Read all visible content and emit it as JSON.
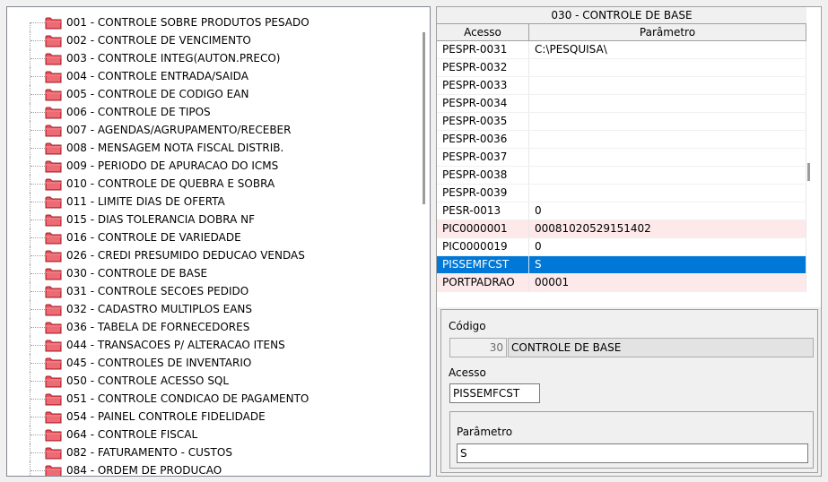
{
  "tree": {
    "items": [
      {
        "label": "001 - CONTROLE SOBRE PRODUTOS PESADO"
      },
      {
        "label": "002 - CONTROLE DE VENCIMENTO"
      },
      {
        "label": "003 - CONTROLE INTEG(AUTON.PRECO)"
      },
      {
        "label": "004 - CONTROLE ENTRADA/SAIDA"
      },
      {
        "label": "005 - CONTROLE DE CODIGO EAN"
      },
      {
        "label": "006 - CONTROLE DE TIPOS"
      },
      {
        "label": "007 - AGENDAS/AGRUPAMENTO/RECEBER"
      },
      {
        "label": "008 - MENSAGEM NOTA FISCAL DISTRIB."
      },
      {
        "label": "009 - PERIODO DE APURACAO DO ICMS"
      },
      {
        "label": "010 - CONTROLE DE QUEBRA E SOBRA"
      },
      {
        "label": "011 - LIMITE DIAS DE OFERTA"
      },
      {
        "label": "015 - DIAS TOLERANCIA DOBRA NF"
      },
      {
        "label": "016 - CONTROLE DE VARIEDADE"
      },
      {
        "label": "026 - CREDI PRESUMIDO DEDUCAO VENDAS"
      },
      {
        "label": "030 - CONTROLE DE BASE"
      },
      {
        "label": "031 - CONTROLE SECOES PEDIDO"
      },
      {
        "label": "032 - CADASTRO MULTIPLOS EANS"
      },
      {
        "label": "036 - TABELA DE FORNECEDORES"
      },
      {
        "label": "044 - TRANSACOES P/ ALTERACAO ITENS"
      },
      {
        "label": "045 - CONTROLES DE INVENTARIO"
      },
      {
        "label": "050 - CONTROLE ACESSO SQL"
      },
      {
        "label": "051 - CONTROLE CONDICAO DE PAGAMENTO"
      },
      {
        "label": "054 - PAINEL CONTROLE FIDELIDADE"
      },
      {
        "label": "064 - CONTROLE  FISCAL"
      },
      {
        "label": "082 - FATURAMENTO - CUSTOS"
      },
      {
        "label": "084 - ORDEM DE PRODUCAO"
      }
    ],
    "folder_icon": "folder-icon",
    "folder_color": "#e8505b"
  },
  "grid": {
    "title": "030 - CONTROLE DE BASE",
    "columns": [
      "Acesso",
      "Parâmetro"
    ],
    "rows": [
      {
        "acesso": "PESPR-0031",
        "parametro": "C:\\PESQUISA\\",
        "state": "normal"
      },
      {
        "acesso": "PESPR-0032",
        "parametro": "",
        "state": "normal"
      },
      {
        "acesso": "PESPR-0033",
        "parametro": "",
        "state": "normal"
      },
      {
        "acesso": "PESPR-0034",
        "parametro": "",
        "state": "normal"
      },
      {
        "acesso": "PESPR-0035",
        "parametro": "",
        "state": "normal"
      },
      {
        "acesso": "PESPR-0036",
        "parametro": "",
        "state": "normal"
      },
      {
        "acesso": "PESPR-0037",
        "parametro": "",
        "state": "normal"
      },
      {
        "acesso": "PESPR-0038",
        "parametro": "",
        "state": "normal"
      },
      {
        "acesso": "PESPR-0039",
        "parametro": "",
        "state": "normal"
      },
      {
        "acesso": "PESR-0013",
        "parametro": "0",
        "state": "normal"
      },
      {
        "acesso": "PIC0000001",
        "parametro": "00081020529151402",
        "state": "pink"
      },
      {
        "acesso": "PIC0000019",
        "parametro": "0",
        "state": "normal"
      },
      {
        "acesso": "PISSEMFCST",
        "parametro": "S",
        "state": "selected"
      },
      {
        "acesso": "PORTPADRAO",
        "parametro": "00001",
        "state": "pink"
      }
    ],
    "colors": {
      "selected": "#0078d7",
      "highlight": "#fde8ea"
    }
  },
  "form": {
    "codigo_label": "Código",
    "codigo_value": "30",
    "codigo_desc": "CONTROLE DE BASE",
    "acesso_label": "Acesso",
    "acesso_value": "PISSEMFCST",
    "parametro_label": "Parâmetro",
    "parametro_value": "S"
  }
}
